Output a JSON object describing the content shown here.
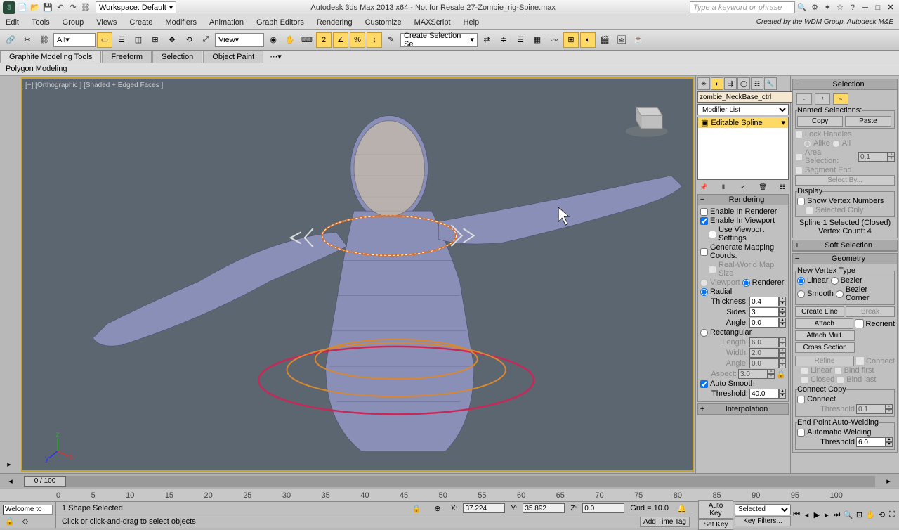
{
  "title": "Autodesk 3ds Max 2013 x64 - Not for Resale    27-Zombie_rig-Spine.max",
  "workspace": "Workspace: Default",
  "search_placeholder": "Type a keyword or phrase",
  "credit": "Created by the WDM Group, Autodesk M&E",
  "menus": [
    "Edit",
    "Tools",
    "Group",
    "Views",
    "Create",
    "Modifiers",
    "Animation",
    "Graph Editors",
    "Rendering",
    "Customize",
    "MAXScript",
    "Help"
  ],
  "selection_filter": "All",
  "ref_coord": "View",
  "create_sel_set": "Create Selection Se",
  "ribbon_tabs": [
    "Graphite Modeling Tools",
    "Freeform",
    "Selection",
    "Object Paint"
  ],
  "poly_mode": "Polygon Modeling",
  "vp_label": "[+] [Orthographic ] [Shaded + Edged Faces ]",
  "object_name": "zombie_NeckBase_ctrl",
  "modifier_list": "Modifier List",
  "mod_item": "Editable Spline",
  "selection": {
    "header": "Selection",
    "named": "Named Selections:",
    "copy": "Copy",
    "paste": "Paste",
    "lock": "Lock Handles",
    "alike": "Alike",
    "all": "All",
    "area": "Area Selection:",
    "area_val": "0.1",
    "seg_end": "Segment End",
    "select_by": "Select By...",
    "display_header": "Display",
    "show_vn": "Show Vertex Numbers",
    "sel_only": "Selected Only",
    "info": "Spline 1 Selected (Closed)\nVertex Count: 4"
  },
  "rendering": {
    "header": "Rendering",
    "en_render": "Enable In Renderer",
    "en_vp": "Enable In Viewport",
    "use_vp": "Use Viewport Settings",
    "gen_map": "Generate Mapping Coords.",
    "real_world": "Real-World Map Size",
    "viewport": "Viewport",
    "renderer": "Renderer",
    "radial": "Radial",
    "thickness": "Thickness:",
    "thickness_val": "0.4",
    "sides": "Sides:",
    "sides_val": "3",
    "angle": "Angle:",
    "angle_val": "0.0",
    "rect": "Rectangular",
    "length": "Length:",
    "length_val": "6.0",
    "width": "Width:",
    "width_val": "2.0",
    "angle2": "Angle:",
    "angle2_val": "0.0",
    "aspect": "Aspect:",
    "aspect_val": "3.0",
    "auto_smooth": "Auto Smooth",
    "threshold": "Threshold:",
    "threshold_val": "40.0"
  },
  "interp_header": "Interpolation",
  "soft_sel": "Soft Selection",
  "geometry": {
    "header": "Geometry",
    "nvt": "New Vertex Type",
    "linear": "Linear",
    "bezier": "Bezier",
    "smooth": "Smooth",
    "bezc": "Bezier Corner",
    "create_line": "Create Line",
    "break": "Break",
    "attach": "Attach",
    "reorient": "Reorient",
    "attach_mult": "Attach Mult.",
    "cross": "Cross Section",
    "refine": "Refine",
    "connect": "Connect",
    "linear2": "Linear",
    "bind_first": "Bind first",
    "closed": "Closed",
    "bind_last": "Bind last",
    "conn_copy": "Connect Copy",
    "connect2": "Connect",
    "threshold": "Threshold",
    "threshold_val": "0.1",
    "end_pt": "End Point Auto-Welding",
    "auto_weld": "Automatic Welding",
    "threshold2": "Threshold",
    "threshold2_val": "6.0"
  },
  "timeline": {
    "frame": "0 / 100",
    "ticks": [
      0,
      5,
      10,
      15,
      20,
      25,
      30,
      35,
      40,
      45,
      50,
      55,
      60,
      65,
      70,
      75,
      80,
      85,
      90,
      95,
      100
    ]
  },
  "status": {
    "welcome": "Welcome to M:",
    "sel": "1 Shape Selected",
    "prompt": "Click or click-and-drag to select objects",
    "x": "37.224",
    "y": "35.892",
    "z": "0.0",
    "grid": "Grid = 10.0",
    "add_tag": "Add Time Tag",
    "auto_key": "Auto Key",
    "set_key": "Set Key",
    "selected": "Selected",
    "key_filters": "Key Filters..."
  }
}
